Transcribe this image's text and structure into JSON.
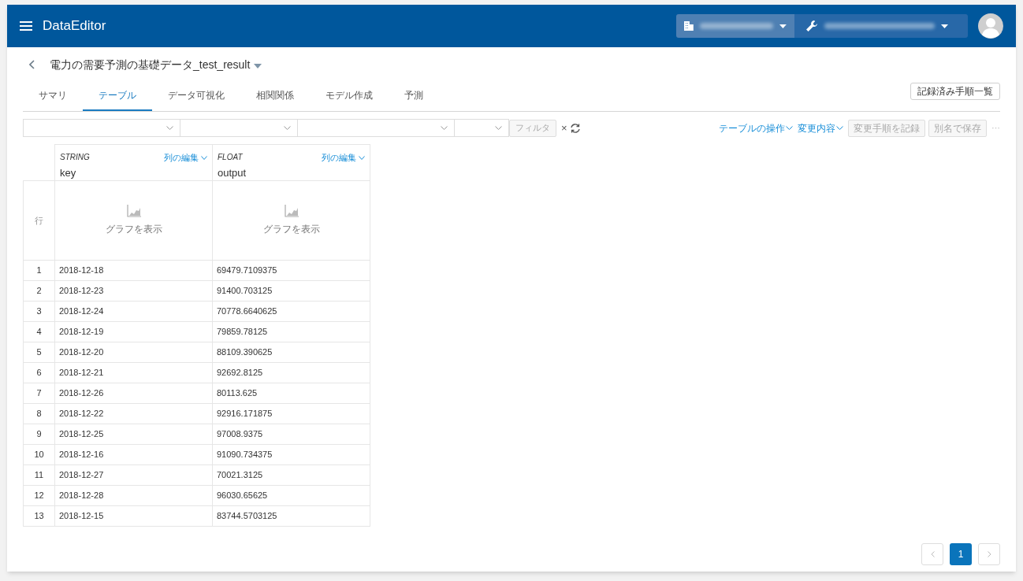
{
  "app": {
    "title": "DataEditor"
  },
  "dataset": {
    "title": "電力の需要予測の基礎データ_test_result"
  },
  "tabs": [
    {
      "label": "サマリ",
      "selected": false
    },
    {
      "label": "テーブル",
      "selected": true
    },
    {
      "label": "データ可視化",
      "selected": false
    },
    {
      "label": "相関関係",
      "selected": false
    },
    {
      "label": "モデル作成",
      "selected": false
    },
    {
      "label": "予測",
      "selected": false
    }
  ],
  "recorded_steps_button": "記録済み手順一覧",
  "filter": {
    "button": "フィルタ",
    "clear": "×"
  },
  "toolbar": {
    "links": [
      "テーブルの操作",
      "変更内容"
    ],
    "buttons": [
      {
        "label": "変更手順を記録",
        "disabled": true
      },
      {
        "label": "別名で保存",
        "disabled": true
      }
    ],
    "more": "···"
  },
  "table": {
    "columns": [
      {
        "kind": "row_number",
        "label": "行"
      },
      {
        "kind": "data",
        "type": "STRING",
        "name": "key",
        "edit_label": "列の編集",
        "graph_label": "グラフを表示"
      },
      {
        "kind": "data",
        "type": "FLOAT",
        "name": "output",
        "edit_label": "列の編集",
        "graph_label": "グラフを表示"
      }
    ],
    "rows": [
      [
        "1",
        "2018-12-18",
        "69479.7109375"
      ],
      [
        "2",
        "2018-12-23",
        "91400.703125"
      ],
      [
        "3",
        "2018-12-24",
        "70778.6640625"
      ],
      [
        "4",
        "2018-12-19",
        "79859.78125"
      ],
      [
        "5",
        "2018-12-20",
        "88109.390625"
      ],
      [
        "6",
        "2018-12-21",
        "92692.8125"
      ],
      [
        "7",
        "2018-12-26",
        "80113.625"
      ],
      [
        "8",
        "2018-12-22",
        "92916.171875"
      ],
      [
        "9",
        "2018-12-25",
        "97008.9375"
      ],
      [
        "10",
        "2018-12-16",
        "91090.734375"
      ],
      [
        "11",
        "2018-12-27",
        "70021.3125"
      ],
      [
        "12",
        "2018-12-28",
        "96030.65625"
      ],
      [
        "13",
        "2018-12-15",
        "83744.5703125"
      ]
    ]
  },
  "pagination": {
    "pages": [
      {
        "label": "1",
        "selected": true
      }
    ]
  }
}
